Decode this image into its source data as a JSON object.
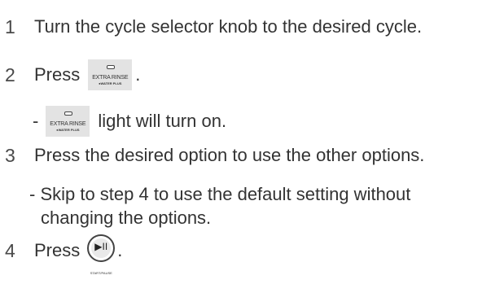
{
  "steps": [
    {
      "number": "1",
      "text": "Turn the cycle selector knob to the desired cycle."
    },
    {
      "number": "2",
      "text_before": "Press",
      "text_after": ".",
      "button": {
        "icon": "extra-rinse-button",
        "label": "EXTRA RINSE",
        "sublabel": "●WATER PLUS"
      },
      "note": {
        "prefix": "-",
        "text": "light will turn on."
      }
    },
    {
      "number": "3",
      "text": "Press the desired option to use the other options.",
      "note": {
        "line1": "- Skip to step 4 to use the default setting without",
        "line2": "changing the options."
      }
    },
    {
      "number": "4",
      "text_before": "Press",
      "text_after": ".",
      "button": {
        "icon": "start-pause-button",
        "glyph": "▶II",
        "label": "START/PAUSE"
      }
    }
  ]
}
